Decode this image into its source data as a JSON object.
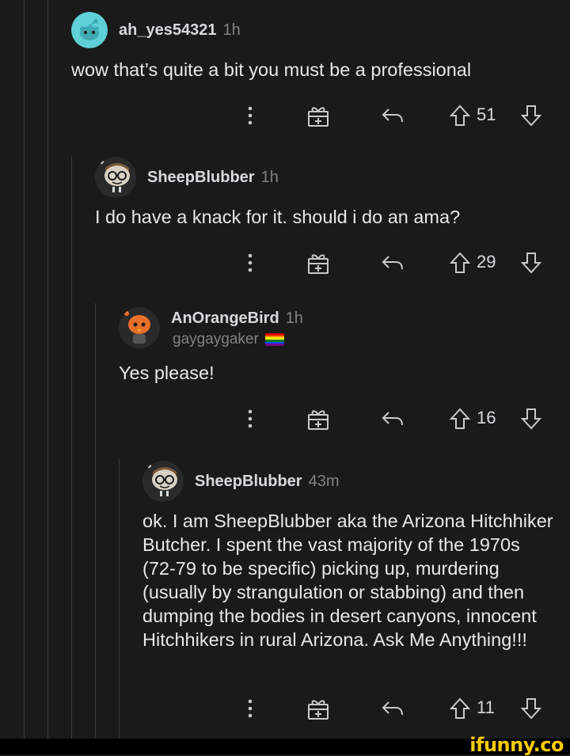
{
  "comments": [
    {
      "username": "ah_yes54321",
      "time": "1h",
      "flair": "",
      "body": "wow that’s quite a bit you must be a professional",
      "score": "51"
    },
    {
      "username": "SheepBlubber",
      "time": "1h",
      "flair": "",
      "body": "I do have a knack for it. should i do an ama?",
      "score": "29"
    },
    {
      "username": "AnOrangeBird",
      "time": "1h",
      "flair": "gaygaygaker",
      "body": "Yes please!",
      "score": "16"
    },
    {
      "username": "SheepBlubber",
      "time": "43m",
      "flair": "",
      "body": "ok. I am SheepBlubber aka the Arizona Hitchhiker Butcher. I spent the vast majority of the 1970s (72-79 to be specific) picking up, murdering (usually by strangulation or stabbing) and then dumping the bodies in desert canyons, innocent Hitchhikers in rural Arizona.  Ask Me Anything!!!",
      "score": "11"
    }
  ],
  "icons": {
    "more": "more-dots-icon",
    "award": "award-icon",
    "reply": "reply-icon",
    "upvote": "upvote-icon",
    "downvote": "downvote-icon",
    "flair_flag": "rainbow-flag-icon"
  },
  "watermark": "ifunny.co",
  "colors": {
    "background": "#1a1a1b",
    "username": "#d7dadc",
    "meta": "#818384",
    "watermark": "#ffcc00"
  }
}
